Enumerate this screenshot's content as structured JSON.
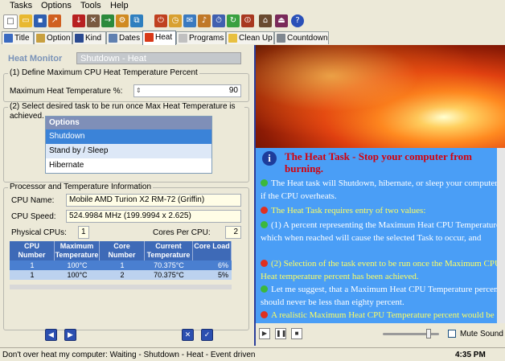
{
  "menu": [
    "Tasks",
    "Options",
    "Tools",
    "Help"
  ],
  "tabs": [
    "Title",
    "Option",
    "Kind",
    "Dates",
    "Heat",
    "Programs",
    "Clean Up",
    "Countdown"
  ],
  "active_tab": "Heat",
  "heat_monitor": {
    "label": "Heat Monitor",
    "value": "Shutdown - Heat"
  },
  "section1": {
    "title": "(1) Define Maximum CPU Heat Temperature Percent",
    "max_temp_label": "Maximum Heat Temperature %:",
    "max_temp_value": "90"
  },
  "section2": {
    "title": "(2) Select desired task to be run once Max Heat Temperature is achieved.",
    "list_header": "Options",
    "options": [
      "Shutdown",
      "Stand by / Sleep",
      "Hibernate"
    ],
    "selected": "Shutdown"
  },
  "processor": {
    "title": "Processor and Temperature Information",
    "cpu_name_label": "CPU Name:",
    "cpu_name": "Mobile AMD Turion X2 RM-72 (Griffin)",
    "cpu_speed_label": "CPU Speed:",
    "cpu_speed": "524.9984 MHz (199.9994 x 2.625)",
    "physical_label": "Physical CPUs:",
    "physical": "1",
    "cores_label": "Cores Per CPU:",
    "cores": "2",
    "columns": [
      "CPU Number",
      "Maximum Temperature",
      "Core Number",
      "Current Temperature",
      "Core Load"
    ],
    "rows": [
      [
        "1",
        "100°C",
        "1",
        "70.375°C",
        "6%"
      ],
      [
        "1",
        "100°C",
        "2",
        "70.375°C",
        "5%"
      ]
    ]
  },
  "help": {
    "title": "The Heat Task - Stop your computer from burning.",
    "paragraphs": [
      {
        "bullet": "green",
        "color": "white",
        "text": "The Heat task will Shutdown, hibernate, or sleep your computer if the CPU overheats."
      },
      {
        "bullet": "red",
        "color": "yellow",
        "text": "The Heat Task requires entry of two values:"
      },
      {
        "bullet": "green",
        "color": "white",
        "text": "(1) A percent representing the Maximum Heat CPU Temperature which when reached will cause the selected Task to occur, and"
      },
      {
        "bullet": "red",
        "color": "yellow",
        "text": "(2) Selection of the task event to be run once the Maximum CPU Heat temperature percent has been achieved."
      },
      {
        "bullet": "green",
        "color": "white",
        "text": "Let me suggest, that a Maximum Heat CPU Temperature percent should never be less than eighty percent."
      },
      {
        "bullet": "red",
        "color": "yellow",
        "text": "A realistic Maximum Heat CPU Temperature percent would be ninety to ninety-five percent."
      }
    ]
  },
  "media": {
    "mute_label": "Mute Sound",
    "volume": 0.85
  },
  "status": {
    "text": "Don't over heat my computer:  Waiting - Shutdown - Heat - Event driven",
    "time": "4:35 PM"
  },
  "colors": {
    "accent": "#3e6ab7",
    "help_bg": "#4a9ef6",
    "title_red": "#d4000c"
  }
}
